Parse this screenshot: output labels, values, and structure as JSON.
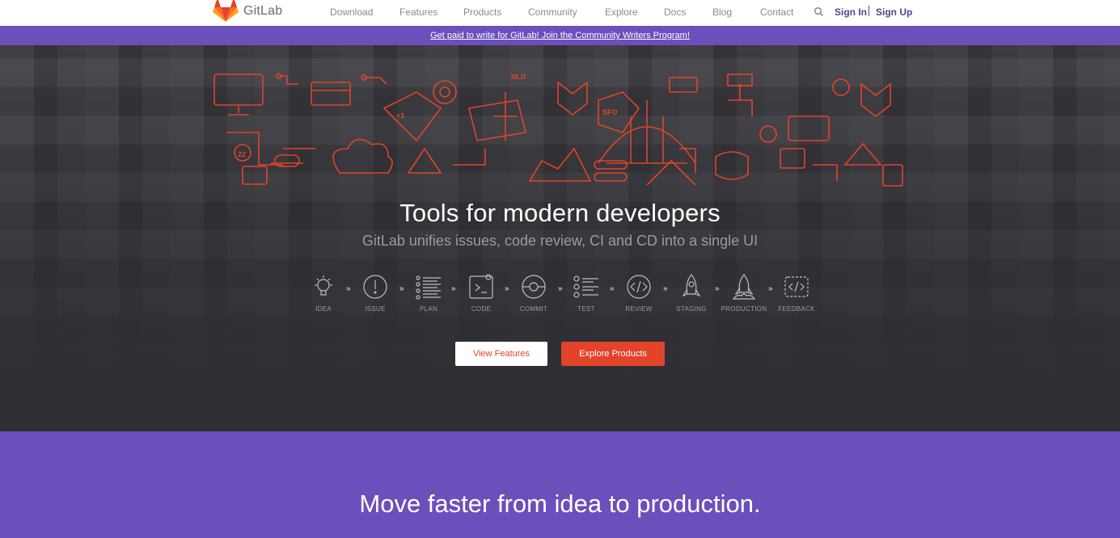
{
  "nav": {
    "brand": "GitLab",
    "links": [
      "Download",
      "Features",
      "Products",
      "Community",
      "Explore",
      "Docs",
      "Blog",
      "Contact"
    ],
    "sign_in": "Sign In",
    "sign_up": "Sign Up"
  },
  "banner": {
    "text": "Get paid to write for GitLab! Join the Community Writers Program!"
  },
  "hero": {
    "title": "Tools for modern developers",
    "subtitle": "GitLab unifies issues, code review, CI and CD into a single UI",
    "stages": [
      "IDEA",
      "ISSUE",
      "PLAN",
      "CODE",
      "COMMIT",
      "TEST",
      "REVIEW",
      "STAGING",
      "PRODUCTION",
      "FEEDBACK"
    ],
    "circuit_labels": [
      "NLD",
      "SFO",
      "+1",
      "22"
    ],
    "view_features": "View Features",
    "explore_products": "Explore Products"
  },
  "section": {
    "title": "Move faster from idea to production."
  },
  "colors": {
    "brand_orange": "#e24329",
    "purple": "#6b4fbb",
    "nav_auth": "#554488"
  },
  "icons": [
    "gitlab-logo-icon",
    "search-icon",
    "lightbulb-icon",
    "issue-icon",
    "plan-list-icon",
    "code-terminal-icon",
    "commit-icon",
    "test-checklist-icon",
    "review-code-icon",
    "staging-rocket-icon",
    "production-rocket-icon",
    "feedback-icon",
    "chevron-right-icon"
  ]
}
